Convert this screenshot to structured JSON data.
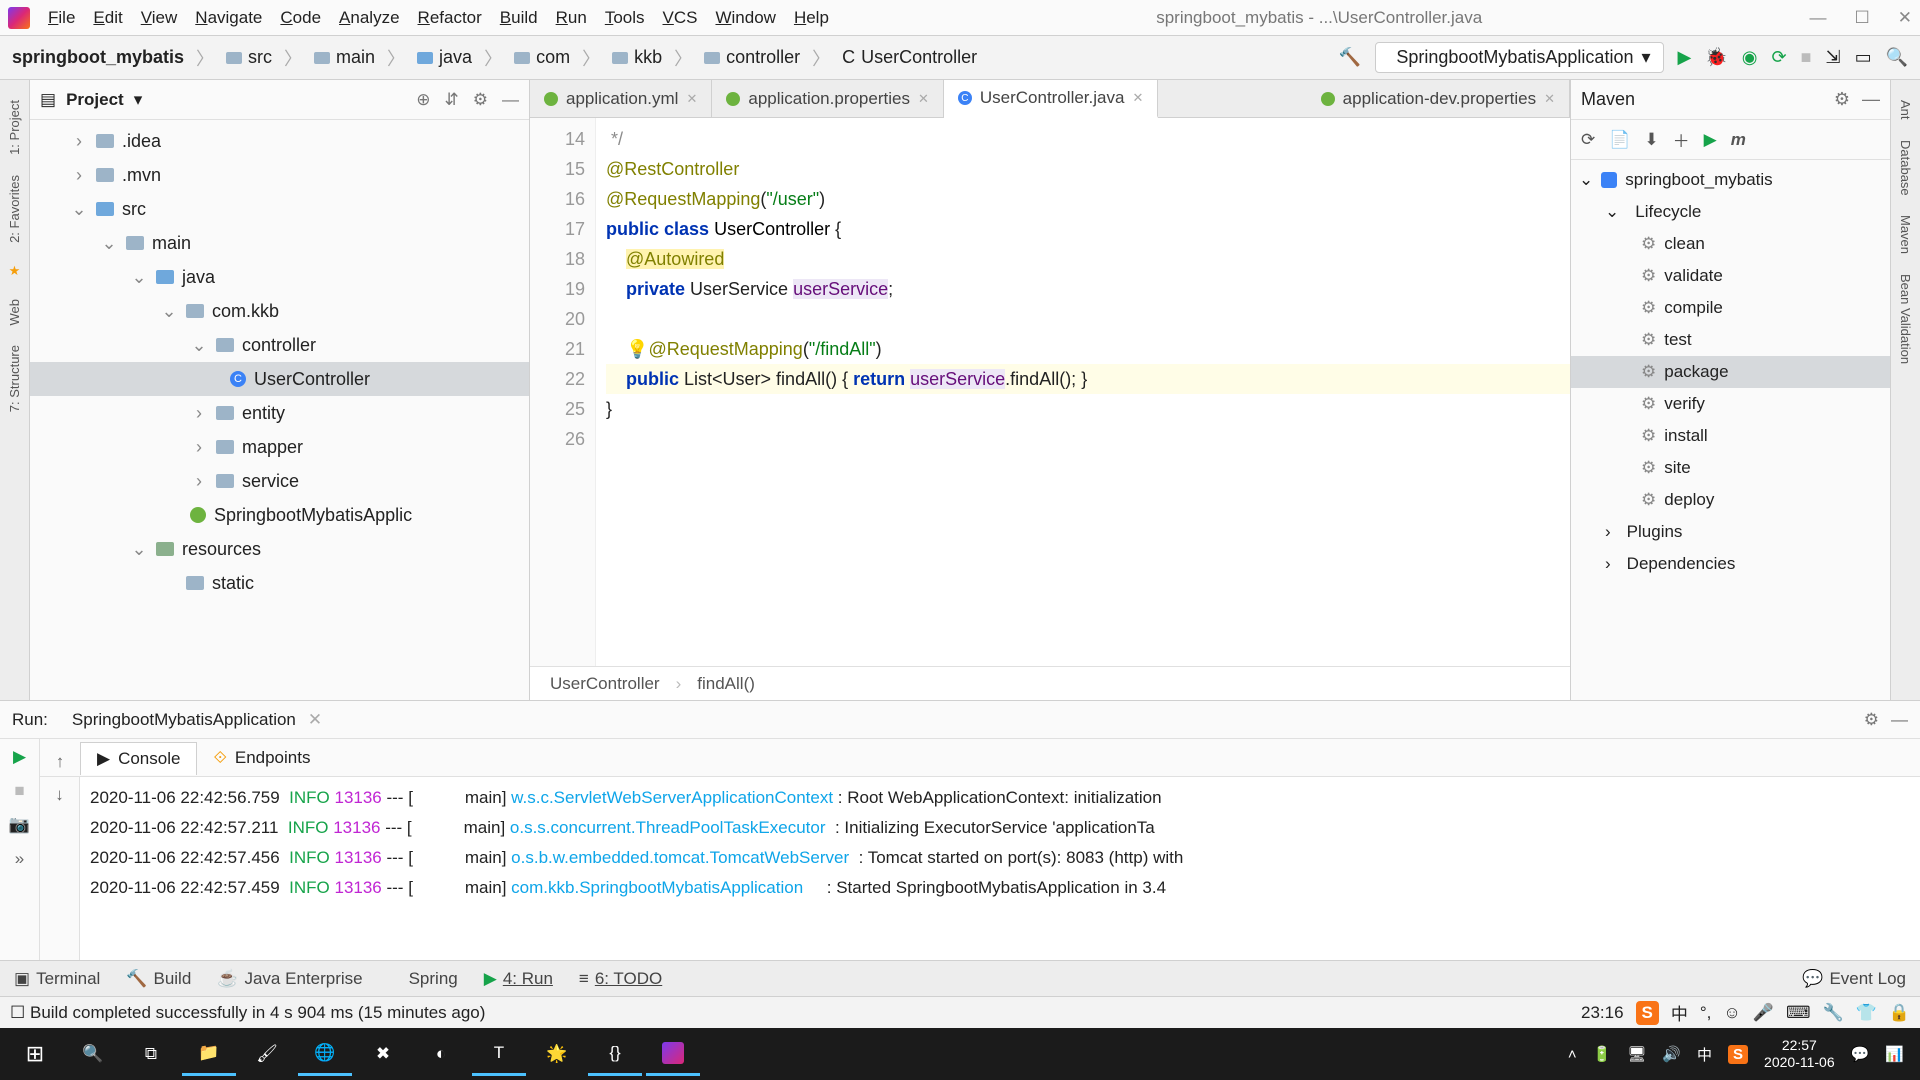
{
  "window": {
    "title": "springboot_mybatis - ...\\UserController.java",
    "menu": [
      "File",
      "Edit",
      "View",
      "Navigate",
      "Code",
      "Analyze",
      "Refactor",
      "Build",
      "Run",
      "Tools",
      "VCS",
      "Window",
      "Help"
    ]
  },
  "breadcrumbs": [
    "springboot_mybatis",
    "src",
    "main",
    "java",
    "com",
    "kkb",
    "controller",
    "UserController"
  ],
  "run_config": "SpringbootMybatisApplication",
  "project": {
    "title": "Project",
    "nodes": {
      "idea": ".idea",
      "mvn": ".mvn",
      "src": "src",
      "main": "main",
      "java": "java",
      "pkg": "com.kkb",
      "controller": "controller",
      "usercontroller": "UserController",
      "entity": "entity",
      "mapper": "mapper",
      "service": "service",
      "app": "SpringbootMybatisApplic",
      "resources": "resources",
      "static": "static"
    }
  },
  "editor": {
    "tabs": [
      {
        "label": "application.yml",
        "kind": "spring",
        "active": false
      },
      {
        "label": "application.properties",
        "kind": "spring",
        "active": false
      },
      {
        "label": "UserController.java",
        "kind": "class",
        "active": true
      },
      {
        "label": "application-dev.properties",
        "kind": "spring",
        "active": false
      }
    ],
    "line_start": 14,
    "lines": [
      " */",
      "@RestController",
      "@RequestMapping(\"/user\")",
      "public class UserController {",
      "    @Autowired",
      "    private UserService userService;",
      "",
      "    @RequestMapping(\"/findAll\")",
      "    public List<User> findAll() { return userService.findAll(); }",
      "}",
      ""
    ],
    "line_numbers": [
      "14",
      "15",
      "16",
      "17",
      "18",
      "19",
      "20",
      "21",
      "22",
      "25",
      "26"
    ],
    "bc": [
      "UserController",
      "findAll()"
    ]
  },
  "maven": {
    "title": "Maven",
    "root": "springboot_mybatis",
    "lifecycle": "Lifecycle",
    "goals": [
      "clean",
      "validate",
      "compile",
      "test",
      "package",
      "verify",
      "install",
      "site",
      "deploy"
    ],
    "plugins": "Plugins",
    "deps": "Dependencies"
  },
  "run": {
    "label": "Run:",
    "name": "SpringbootMybatisApplication",
    "tabs": [
      "Console",
      "Endpoints"
    ],
    "lines": [
      {
        "ts": "2020-11-06 22:42:56.759",
        "lvl": "INFO",
        "pid": "13136",
        "pre": " --- [           main] ",
        "cls": "w.s.c.ServletWebServerApplicationContext",
        "msg": " : Root WebApplicationContext: initialization "
      },
      {
        "ts": "2020-11-06 22:42:57.211",
        "lvl": "INFO",
        "pid": "13136",
        "pre": " --- [           main] ",
        "cls": "o.s.s.concurrent.ThreadPoolTaskExecutor",
        "msg": "  : Initializing ExecutorService 'applicationTa"
      },
      {
        "ts": "2020-11-06 22:42:57.456",
        "lvl": "INFO",
        "pid": "13136",
        "pre": " --- [           main] ",
        "cls": "o.s.b.w.embedded.tomcat.TomcatWebServer",
        "msg": "  : Tomcat started on port(s): 8083 (http) with"
      },
      {
        "ts": "2020-11-06 22:42:57.459",
        "lvl": "INFO",
        "pid": "13136",
        "pre": " --- [           main] ",
        "cls": "com.kkb.SpringbootMybatisApplication",
        "msg": "     : Started SpringbootMybatisApplication in 3.4"
      }
    ]
  },
  "bottom_tabs": [
    "Terminal",
    "Build",
    "Java Enterprise",
    "Spring",
    "4: Run",
    "6: TODO"
  ],
  "bottom_right": "Event Log",
  "status": {
    "msg": "Build completed successfully in 4 s 904 ms (15 minutes ago)",
    "time": "23:16"
  },
  "taskbar": {
    "time": "22:57",
    "date": "2020-11-06"
  },
  "left_tools": [
    "1: Project",
    "2: Favorites",
    "Web",
    "7: Structure"
  ],
  "right_tools": [
    "Ant",
    "Database",
    "Maven",
    "Bean Validation"
  ]
}
